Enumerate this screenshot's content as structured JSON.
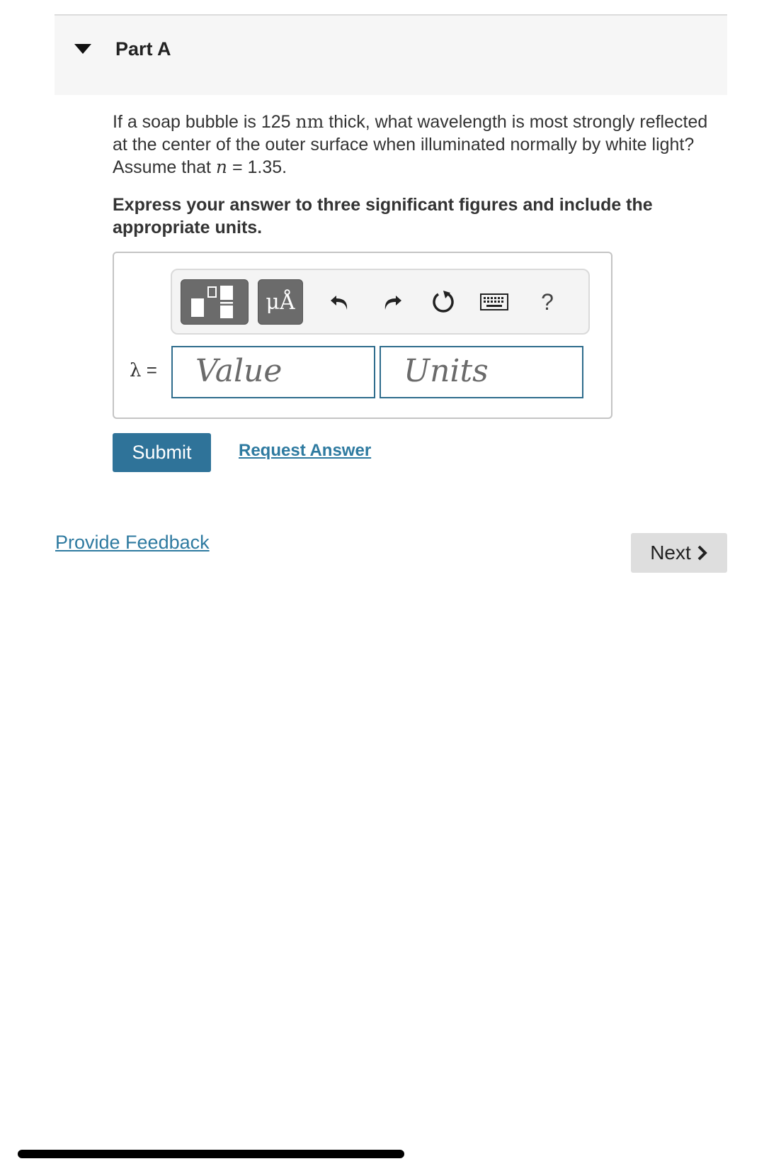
{
  "part": {
    "title": "Part A"
  },
  "question": {
    "text_before": "If a soap bubble is 125 ",
    "unit": "nm",
    "text_middle": " thick, what wavelength is most strongly reflected at the center of the outer surface when illuminated normally by white light? Assume that ",
    "var": "n",
    "text_after": " = 1.35."
  },
  "instruction": "Express your answer to three significant figures and include the appropriate units.",
  "toolbar": {
    "units_label": "μÅ",
    "help_label": "?",
    "icons": [
      "templates-icon",
      "units-icon",
      "undo-icon",
      "redo-icon",
      "reset-icon",
      "keyboard-icon",
      "help-icon"
    ]
  },
  "answer": {
    "label_symbol": "λ",
    "label_eq": " =",
    "value_placeholder": "Value",
    "units_placeholder": "Units"
  },
  "actions": {
    "submit_label": "Submit",
    "request_label": "Request Answer"
  },
  "footer": {
    "feedback_label": "Provide Feedback",
    "next_label": "Next"
  },
  "colors": {
    "accent": "#2f7399",
    "link": "#2e7aa0",
    "field_border": "#2e6c8c"
  }
}
